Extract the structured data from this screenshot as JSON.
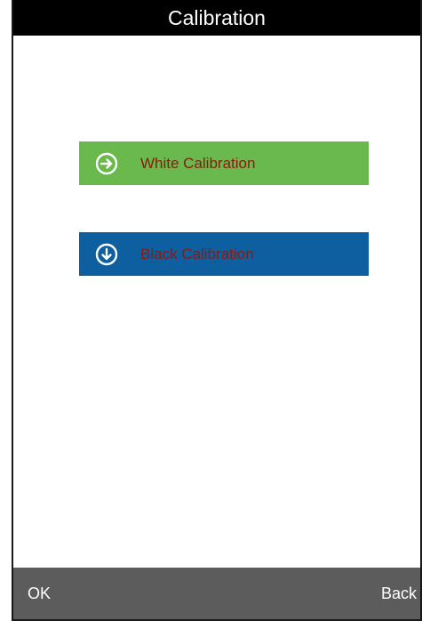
{
  "header": {
    "title": "Calibration"
  },
  "calibration_options": [
    {
      "label": "White Calibration",
      "icon": "arrow-right-circle-icon",
      "background": "#6ab94c"
    },
    {
      "label": "Black Calibration",
      "icon": "arrow-down-circle-icon",
      "background": "#0d5f9f"
    }
  ],
  "softkeys": {
    "ok_label": "OK",
    "back_label": "Back"
  },
  "colors": {
    "title_bar": "#000000",
    "bottom_bar": "#5c5c5c",
    "label_text": "#8b1a12"
  }
}
